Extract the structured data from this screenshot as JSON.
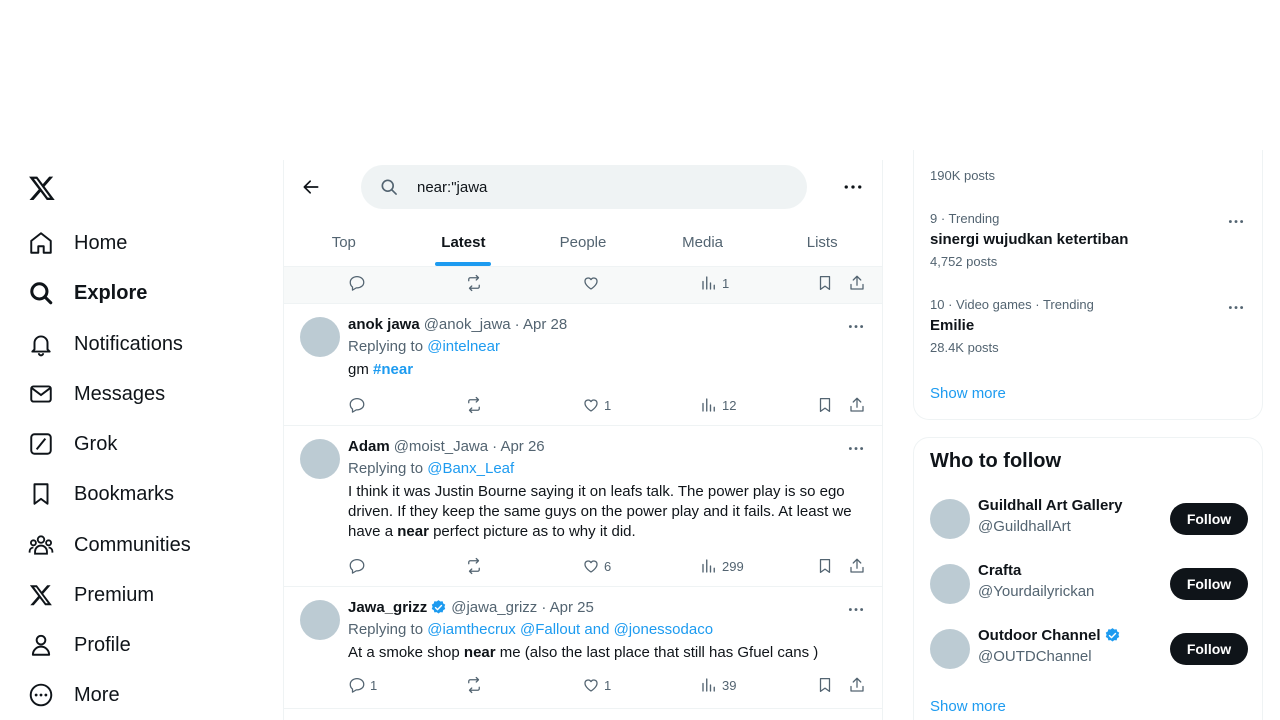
{
  "app": {
    "brand_color": "#1d9bf0",
    "text_color": "#0f1419",
    "muted_color": "#536471"
  },
  "nav": {
    "logo": "x-logo-icon",
    "items": [
      {
        "label": "Home",
        "icon": "home-icon"
      },
      {
        "label": "Explore",
        "icon": "search-icon",
        "active": true
      },
      {
        "label": "Notifications",
        "icon": "bell-icon"
      },
      {
        "label": "Messages",
        "icon": "envelope-icon"
      },
      {
        "label": "Grok",
        "icon": "grok-icon"
      },
      {
        "label": "Bookmarks",
        "icon": "bookmark-icon"
      },
      {
        "label": "Communities",
        "icon": "communities-icon"
      },
      {
        "label": "Premium",
        "icon": "x-logo-icon"
      },
      {
        "label": "Profile",
        "icon": "person-icon"
      },
      {
        "label": "More",
        "icon": "more-circle-icon"
      }
    ]
  },
  "search": {
    "value": "near:\"jawa",
    "placeholder": "Search"
  },
  "tabs": [
    {
      "label": "Top"
    },
    {
      "label": "Latest",
      "active": true
    },
    {
      "label": "People"
    },
    {
      "label": "Media"
    },
    {
      "label": "Lists"
    }
  ],
  "prev_tweet": {
    "views": "1"
  },
  "tweets": [
    {
      "name": "anok jawa",
      "handle": "@anok_jawa",
      "date": "· Apr 28",
      "replying_prefix": "Replying to",
      "replying_to": "@intelnear",
      "text_plain": "gm",
      "text_hashtag": "#near",
      "replies": "",
      "likes": "1",
      "views": "12"
    },
    {
      "name": "Adam",
      "handle": "@moist_Jawa",
      "date": "· Apr 26",
      "replying_prefix": "Replying to",
      "replying_to": "@Banx_Leaf",
      "text_before": "I think it was Justin Bourne saying it on leafs talk. The power play is so ego driven. If they keep the same guys on the power play and it fails. At least we have a",
      "text_bold": "near",
      "text_after": "perfect picture as to why it did.",
      "replies": "",
      "likes": "6",
      "views": "299"
    },
    {
      "name": "Jawa_grizz",
      "verified": true,
      "handle": "@jawa_grizz",
      "date": "· Apr 25",
      "replying_prefix": "Replying to",
      "replying_to": "@iamthecrux @Fallout and @jonessodaco",
      "text_before": "At a smoke shop",
      "text_bold": "near",
      "text_after": "me (also the last place that still has Gfuel cans )",
      "replies": "1",
      "likes": "1",
      "views": "39"
    }
  ],
  "trends": {
    "top_count": "190K posts",
    "items": [
      {
        "meta": "9 · Trending",
        "title": "sinergi wujudkan ketertiban",
        "count": "4,752 posts"
      },
      {
        "meta": "10 · Video games · Trending",
        "title": "Emilie",
        "count": "28.4K posts"
      }
    ],
    "show_more": "Show more"
  },
  "who_to_follow": {
    "title": "Who to follow",
    "accounts": [
      {
        "name": "Guildhall Art Gallery",
        "handle": "@GuildhallArt",
        "verified": false,
        "button": "Follow"
      },
      {
        "name": "Crafta",
        "handle": "@Yourdailyrickan",
        "verified": false,
        "button": "Follow"
      },
      {
        "name": "Outdoor Channel",
        "handle": "@OUTDChannel",
        "verified": true,
        "button": "Follow"
      }
    ],
    "show_more": "Show more"
  }
}
